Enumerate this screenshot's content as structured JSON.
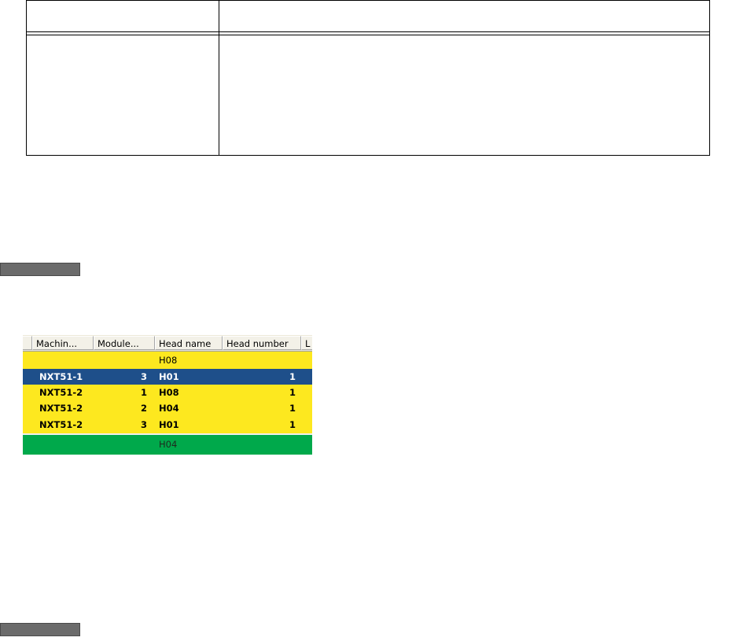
{
  "grid": {
    "columns": [
      {
        "label": ""
      },
      {
        "label": "Machin..."
      },
      {
        "label": "Module..."
      },
      {
        "label": "Head name"
      },
      {
        "label": "Head number"
      },
      {
        "label": "L"
      }
    ],
    "rows": [
      {
        "machine": "",
        "module": "",
        "head": "H08",
        "head_number": "",
        "style": "yellow",
        "bold": false
      },
      {
        "machine": "NXT51-1",
        "module": "3",
        "head": "H01",
        "head_number": "1",
        "style": "selected",
        "bold": true
      },
      {
        "machine": "NXT51-2",
        "module": "1",
        "head": "H08",
        "head_number": "1",
        "style": "yellow",
        "bold": true
      },
      {
        "machine": "NXT51-2",
        "module": "2",
        "head": "H04",
        "head_number": "1",
        "style": "yellow",
        "bold": true
      },
      {
        "machine": "NXT51-2",
        "module": "3",
        "head": "H01",
        "head_number": "1",
        "style": "yellow",
        "bold": true
      },
      {
        "machine": "",
        "module": "",
        "head": "H04",
        "head_number": "",
        "style": "green",
        "bold": false
      }
    ]
  },
  "colors": {
    "row_yellow": "#fde81f",
    "row_selected": "#1e4f8a",
    "row_green": "#00a94b",
    "marker_gray": "#6b6b6b"
  }
}
